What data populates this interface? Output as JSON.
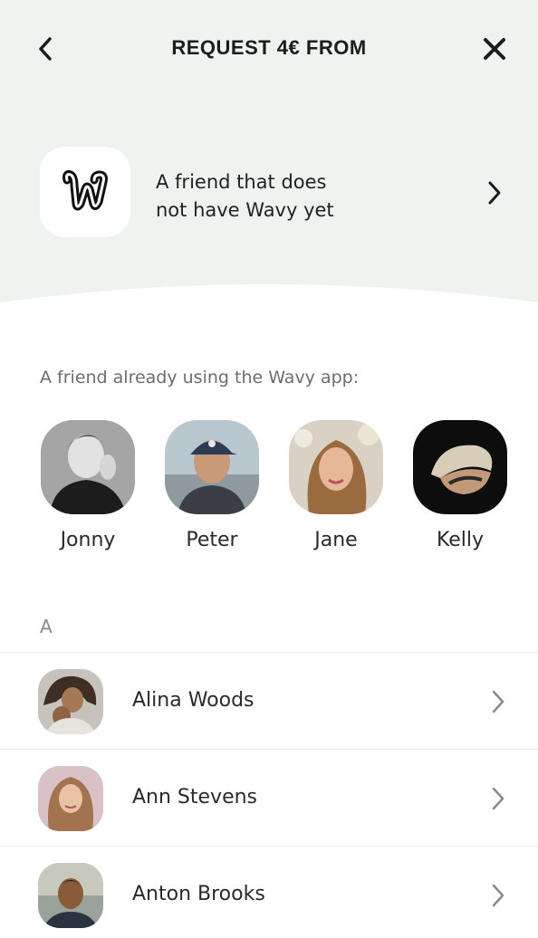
{
  "header": {
    "title": "REQUEST 4€ FROM",
    "back_icon": "chevron-left-icon",
    "close_icon": "close-icon"
  },
  "invite": {
    "logo_icon": "wavy-logo-icon",
    "line1": "A friend that does",
    "line2": "not have Wavy yet",
    "chevron_icon": "chevron-right-icon"
  },
  "friends_section": {
    "label": "A friend already using the Wavy app:",
    "friends": [
      {
        "name": "Jonny"
      },
      {
        "name": "Peter"
      },
      {
        "name": "Jane"
      },
      {
        "name": "Kelly"
      }
    ]
  },
  "contacts": {
    "letter": "A",
    "items": [
      {
        "name": "Alina Woods"
      },
      {
        "name": "Ann Stevens"
      },
      {
        "name": "Anton Brooks"
      }
    ]
  },
  "colors": {
    "top_background": "#eef3ef",
    "text": "#1f1f1f",
    "muted": "#6d6d6d"
  }
}
